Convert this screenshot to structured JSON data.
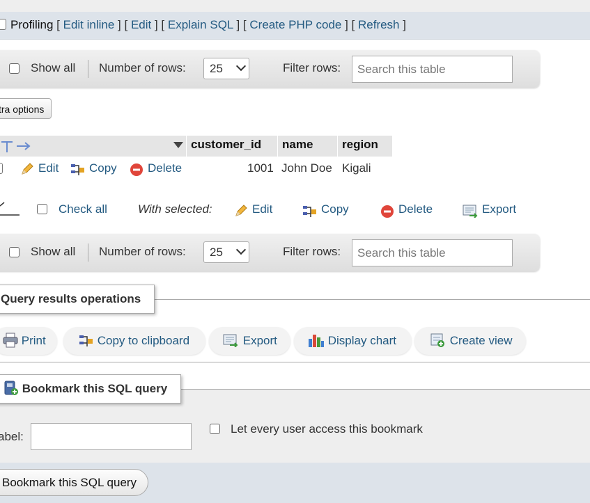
{
  "profiling": {
    "label": "Profiling",
    "links": [
      "Edit inline",
      "Edit",
      "Explain SQL",
      "Create PHP code",
      "Refresh"
    ]
  },
  "nav_top": {
    "show_all": "Show all",
    "rows_label": "Number of rows:",
    "rows_value": "25",
    "filter_label": "Filter rows:",
    "search_placeholder": "Search this table"
  },
  "extra_options": "xtra options",
  "table": {
    "headers": [
      "customer_id",
      "name",
      "region"
    ],
    "row": {
      "actions": [
        "Edit",
        "Copy",
        "Delete"
      ],
      "cells": [
        "1001",
        "John Doe",
        "Kigali"
      ]
    }
  },
  "bulk": {
    "check_all": "Check all",
    "with_selected": "With selected:",
    "actions": [
      "Edit",
      "Copy",
      "Delete",
      "Export"
    ]
  },
  "nav_bottom": {
    "show_all": "Show all",
    "rows_label": "Number of rows:",
    "rows_value": "25",
    "filter_label": "Filter rows:",
    "search_placeholder": "Search this table"
  },
  "query_ops": {
    "legend": "Query results operations",
    "buttons": [
      "Print",
      "Copy to clipboard",
      "Export",
      "Display chart",
      "Create view"
    ]
  },
  "bookmark": {
    "legend": "Bookmark this SQL query",
    "label_text": "abel:",
    "label_value": "",
    "share_label": "Let every user access this bookmark",
    "submit": "Bookmark this SQL query"
  },
  "colors": {
    "link": "#235a81",
    "bar_blue": "#dde3ea",
    "delete_red": "#e0453a"
  }
}
